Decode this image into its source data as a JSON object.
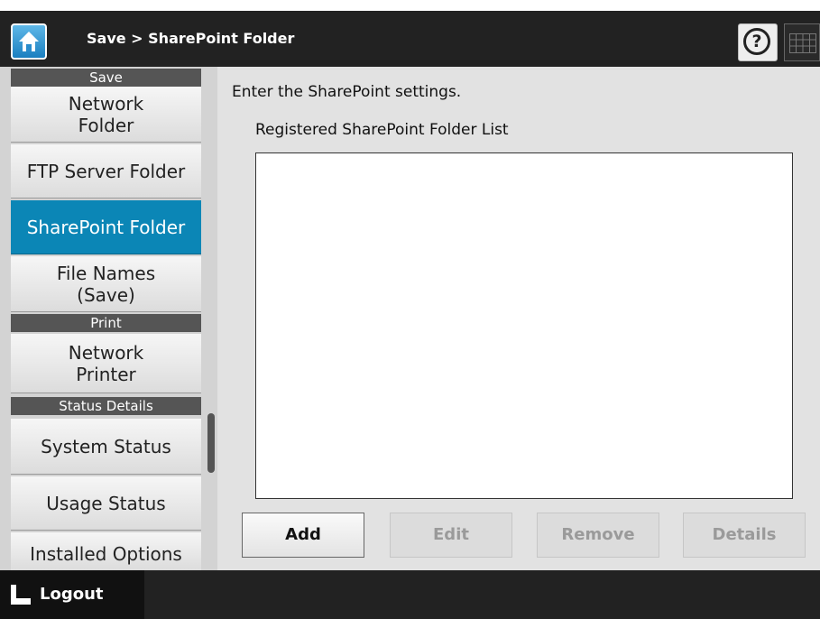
{
  "header": {
    "title": "Save > SharePoint Folder",
    "home_icon": "home-icon",
    "help_icon": "help-icon",
    "keyboard_icon": "keyboard-icon"
  },
  "sidebar": {
    "sections": [
      {
        "label": "Save"
      },
      {
        "label": "Print"
      },
      {
        "label": "Status Details"
      }
    ],
    "items": [
      {
        "lines": [
          "Network",
          "Folder"
        ],
        "active": false
      },
      {
        "lines": [
          "FTP Server Folder"
        ],
        "active": false
      },
      {
        "lines": [
          "SharePoint Folder"
        ],
        "active": true
      },
      {
        "lines": [
          "File Names",
          "(Save)"
        ],
        "active": false
      },
      {
        "lines": [
          "Network",
          "Printer"
        ],
        "active": false
      },
      {
        "lines": [
          "System Status"
        ],
        "active": false
      },
      {
        "lines": [
          "Usage Status"
        ],
        "active": false
      },
      {
        "lines": [
          "Installed Options"
        ],
        "active": false
      }
    ]
  },
  "main": {
    "instruction": "Enter the SharePoint settings.",
    "list_label": "Registered SharePoint Folder List",
    "list_items": [],
    "buttons": {
      "add": "Add",
      "edit": "Edit",
      "remove": "Remove",
      "details": "Details"
    },
    "button_states": {
      "add": "enabled",
      "edit": "disabled",
      "remove": "disabled",
      "details": "disabled"
    }
  },
  "footer": {
    "logout_label": "Logout",
    "logout_icon": "logout-icon"
  },
  "colors": {
    "header_bg": "#222222",
    "active_item": "#0b86b6",
    "section_header": "#555555",
    "content_bg": "#e2e2e2"
  }
}
